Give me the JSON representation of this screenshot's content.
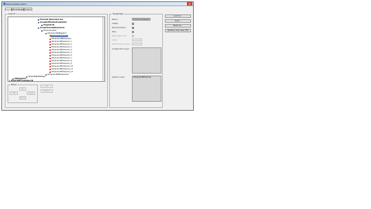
{
  "window": {
    "title": "PersonalizationDCO"
  },
  "tabs": [
    {
      "label": "Layout",
      "active": true
    },
    {
      "label": "Workbasket",
      "active": false
    },
    {
      "label": "Query",
      "active": false
    }
  ],
  "layout_group": {
    "label": "Layout"
  },
  "tree": {
    "nodes": [
      {
        "label": "Financial dimensions box",
        "bold": true
      },
      {
        "label": "GroupNotificationTemplateId",
        "bold": true
      },
      {
        "label": "Template ID",
        "bold": true
      },
      {
        "label": "GroupFinancialDimensions",
        "bold": true
      },
      {
        "label": "DimensionsGrid",
        "bold": false
      },
      {
        "label": "DimensionTabPageGrid",
        "bold": false
      },
      {
        "label": "Financial dimension",
        "bold": false,
        "selected": true
      },
      {
        "label": "DimensionIdEDimension",
        "bold": false
      },
      {
        "label": "DimensionEDimension_1",
        "bold": false
      },
      {
        "label": "DimensionEDimension_2",
        "bold": false
      },
      {
        "label": "DimensionEDimension_3",
        "bold": false
      },
      {
        "label": "DimensionEDimension_4",
        "bold": false
      },
      {
        "label": "DimensionEDimension_5",
        "bold": false
      },
      {
        "label": "DimensionEDimension_6",
        "bold": false
      },
      {
        "label": "DimensionEDimension_7",
        "bold": false
      },
      {
        "label": "DimensionEDimension_8",
        "bold": false
      },
      {
        "label": "DimensionEDimension_9",
        "bold": false
      },
      {
        "label": "DimensionEDimension_10",
        "bold": false
      },
      {
        "label": "DimensionEDimension_11",
        "bold": false
      },
      {
        "label": "DimensionEDimension_12",
        "bold": false
      },
      {
        "label": "DimensionEditDimensions",
        "bold": false
      },
      {
        "label": "HeaderRightTabPage",
        "bold": false
      },
      {
        "label": "TabPageGrid",
        "bold": true
      },
      {
        "label": "Email ItEM templates ID",
        "bold": true
      }
    ]
  },
  "move_group": {
    "label": "Move",
    "buttons": [
      "Up",
      "Down",
      "Left",
      "Right",
      "Top",
      "Bottom"
    ]
  },
  "properties": {
    "label": "Properties",
    "rows": [
      {
        "label": "Name:",
        "value": "Financial dimension",
        "type": "text",
        "enabled": true
      },
      {
        "label": "Visible:",
        "type": "check",
        "checked": true,
        "enabled": true
      },
      {
        "label": "Edit permission:",
        "type": "check",
        "checked": true,
        "enabled": true
      },
      {
        "label": "Skip:",
        "type": "check",
        "checked": false,
        "enabled": true
      },
      {
        "label": "Right alignment:",
        "type": "text",
        "value": "",
        "enabled": false
      },
      {
        "label": "Label:",
        "type": "text",
        "value": "",
        "enabled": false
      },
      {
        "label": "Width of the column:",
        "type": "text",
        "value": "",
        "enabled": false
      }
    ],
    "configuration_layer_label": "Configuration layer:",
    "system_name_label": "System name:",
    "system_name_value": "DimensionIDFinancial"
  },
  "right_buttons": [
    "Load Up...",
    "Save...",
    "Reset Up...",
    "Redefine Tree View (F5)"
  ]
}
